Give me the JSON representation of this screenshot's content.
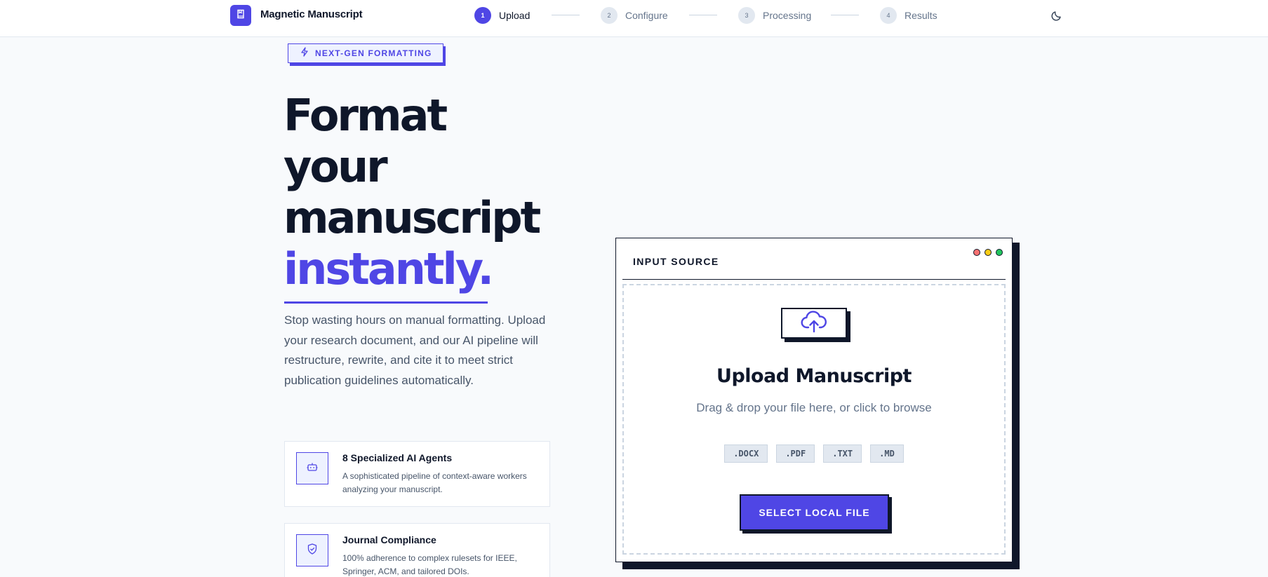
{
  "app": {
    "title": "Magnetic Manuscript",
    "logo_icon": "book-icon",
    "accent_color": "#4f46e5"
  },
  "stepper": [
    {
      "number": "1",
      "label": "Upload",
      "active": true
    },
    {
      "number": "2",
      "label": "Configure",
      "active": false
    },
    {
      "number": "3",
      "label": "Processing",
      "active": false
    },
    {
      "number": "4",
      "label": "Results",
      "active": false
    }
  ],
  "theme_toggle": {
    "icon": "moon-icon"
  },
  "badge": {
    "label": "NEXT-GEN FORMATTING",
    "icon": "lightning-icon"
  },
  "hero": {
    "line1": "Format",
    "line2": "your",
    "line3": "manuscript",
    "accent": "instantly.",
    "description": "Stop wasting hours on manual formatting. Upload your research document, and our AI pipeline will restructure, rewrite, and cite it to meet strict publication guidelines automatically."
  },
  "features": [
    {
      "icon": "bot-icon",
      "title": "8 Specialized AI Agents",
      "description": "A sophisticated pipeline of context-aware workers analyzing your manuscript."
    },
    {
      "icon": "shield-check-icon",
      "title": "Journal Compliance",
      "description": "100% adherence to complex rulesets for IEEE, Springer, ACM, and tailored DOIs."
    }
  ],
  "upload": {
    "panel_title": "INPUT SOURCE",
    "window_dot_colors": [
      "#f87171",
      "#facc15",
      "#22c55e"
    ],
    "icon": "cloud-upload-icon",
    "title": "Upload Manuscript",
    "subtitle": "Drag & drop your file here, or click to browse",
    "formats": [
      ".DOCX",
      ".PDF",
      ".TXT",
      ".MD"
    ],
    "button_label": "SELECT LOCAL FILE"
  }
}
